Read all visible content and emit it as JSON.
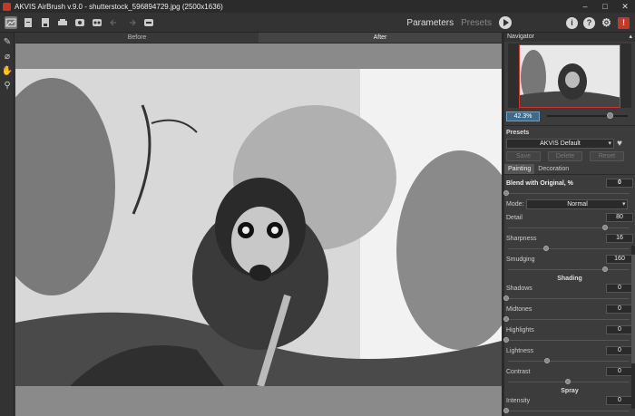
{
  "window": {
    "title": "AKVIS AirBrush v.9.0 - shutterstock_596894729.jpg (2500x1636)",
    "minimize": "–",
    "maximize": "□",
    "close": "✕"
  },
  "toolbar": {
    "parameters_tab": "Parameters",
    "presets_tab": "Presets",
    "icons": [
      "home-icon",
      "open-icon",
      "save-icon",
      "print-icon",
      "share-icon",
      "batch-icon",
      "undo-icon",
      "redo-icon",
      "settings-toggle-icon"
    ]
  },
  "right_icons": {
    "info": "i",
    "help": "?",
    "gear": "⚙",
    "logo": "!"
  },
  "left_tools": [
    "brush-icon",
    "eraser-icon",
    "hand-icon",
    "zoom-icon"
  ],
  "view": {
    "before": "Before",
    "after": "After"
  },
  "navigator": {
    "label": "Navigator",
    "zoom": "42.3%",
    "zoom_fraction": 0.78
  },
  "presets": {
    "label": "Presets",
    "selected": "AKVIS Default",
    "save": "Save",
    "delete": "Delete",
    "reset": "Reset"
  },
  "tabs": {
    "painting": "Painting",
    "decoration": "Decoration"
  },
  "params": {
    "blend": {
      "label": "Blend with Original, %",
      "value": "0",
      "fraction": 0.0
    },
    "mode": {
      "label": "Mode:",
      "value": "Normal"
    },
    "detail": {
      "label": "Detail",
      "value": "80",
      "fraction": 0.8
    },
    "sharpness": {
      "label": "Sharpness",
      "value": "16",
      "fraction": 0.32
    },
    "smudging": {
      "label": "Smudging",
      "value": "160",
      "fraction": 0.8
    },
    "shading": {
      "title": "Shading",
      "shadows": {
        "label": "Shadows",
        "value": "0",
        "fraction": 0.0
      },
      "midtones": {
        "label": "Midtones",
        "value": "0",
        "fraction": 0.0
      },
      "highlights": {
        "label": "Highlights",
        "value": "0",
        "fraction": 0.0
      },
      "lightness": {
        "label": "Lightness",
        "value": "0",
        "fraction": 0.33
      },
      "contrast": {
        "label": "Contrast",
        "value": "0",
        "fraction": 0.5
      }
    },
    "spray": {
      "title": "Spray",
      "intensity": {
        "label": "Intensity",
        "value": "0",
        "fraction": 0.0
      }
    }
  }
}
